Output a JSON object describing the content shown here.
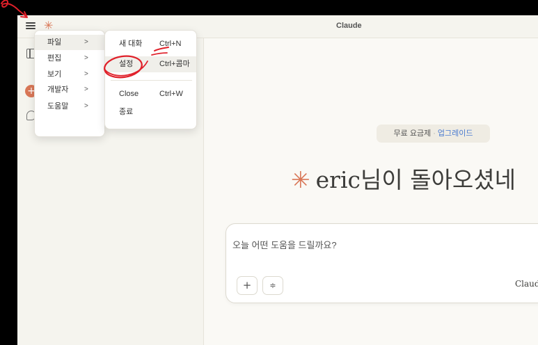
{
  "window": {
    "title": "Claude",
    "logo_glyph": "✳"
  },
  "menu": {
    "main_items": [
      {
        "label": "파일",
        "chevron": ">"
      },
      {
        "label": "편집",
        "chevron": ">"
      },
      {
        "label": "보기",
        "chevron": ">"
      },
      {
        "label": "개발자",
        "chevron": ">"
      },
      {
        "label": "도움말",
        "chevron": ">"
      }
    ],
    "file_submenu": [
      {
        "label": "새 대화",
        "shortcut": "Ctrl+N"
      },
      {
        "label": "설정",
        "shortcut": "Ctrl+콤마"
      },
      {
        "label": "Close",
        "shortcut": "Ctrl+W"
      },
      {
        "label": "종료",
        "shortcut": ""
      }
    ]
  },
  "main": {
    "plan_label": "무료 요금제",
    "plan_separator": "·",
    "upgrade_label": "업그레이드",
    "greeting": "eric님이 돌아오셨네",
    "greeting_icon": "✳",
    "composer": {
      "placeholder": "오늘 어떤 도움을 드릴까요?",
      "plus_label": "+",
      "tools_label": "≑",
      "model_name": "Claude"
    }
  },
  "colors": {
    "accent": "#d97757",
    "annotation": "#e0202a",
    "link": "#4a7bd0"
  }
}
